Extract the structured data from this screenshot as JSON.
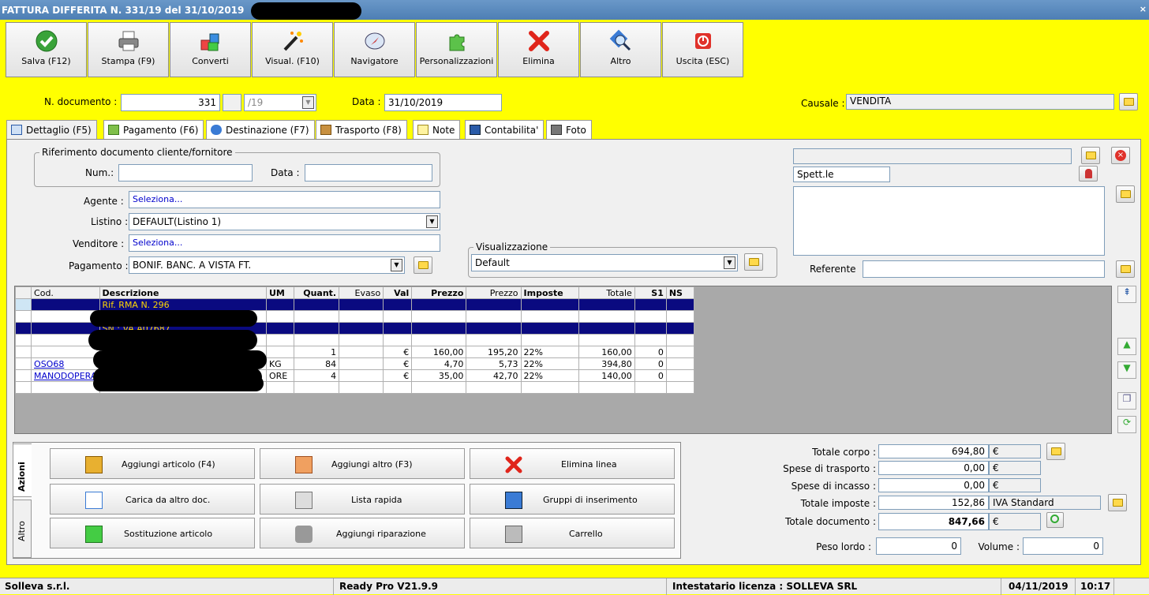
{
  "window": {
    "title": "FATTURA DIFFERITA N. 331/19 del 31/10/2019",
    "close": "×"
  },
  "toolbar": [
    {
      "label": "Salva (F12)",
      "icon": "save-check-icon"
    },
    {
      "label": "Stampa (F9)",
      "icon": "printer-icon"
    },
    {
      "label": "Converti",
      "icon": "convert-icon"
    },
    {
      "label": "Visual. (F10)",
      "icon": "magic-wand-icon"
    },
    {
      "label": "Navigatore",
      "icon": "compass-icon"
    },
    {
      "label": "Personalizzazioni",
      "icon": "puzzle-icon"
    },
    {
      "label": "Elimina",
      "icon": "delete-x-icon"
    },
    {
      "label": "Altro",
      "icon": "search-icon"
    },
    {
      "label": "Uscita (ESC)",
      "icon": "power-icon"
    }
  ],
  "header": {
    "ndoc_label": "N. documento :",
    "ndoc_value": "331",
    "suffix": "/19",
    "data_label": "Data :",
    "data_value": "31/10/2019",
    "causale_label": "Causale :",
    "causale_value": "VENDITA"
  },
  "tabs": [
    "Dettaglio (F5)",
    "Pagamento (F6)",
    "Destinazione (F7)",
    "Trasporto (F8)",
    "Note",
    "Contabilita'",
    "Foto"
  ],
  "rif": {
    "legend": "Riferimento documento cliente/fornitore",
    "num_label": "Num.:",
    "data_label": "Data :"
  },
  "form": {
    "agente_label": "Agente :",
    "agente_value": "Seleziona...",
    "listino_label": "Listino :",
    "listino_value": "DEFAULT(Listino 1)",
    "venditore_label": "Venditore :",
    "venditore_value": "Seleziona...",
    "pagamento_label": "Pagamento :",
    "pagamento_value": "BONIF. BANC. A VISTA FT."
  },
  "visual": {
    "legend": "Visualizzazione",
    "value": "Default"
  },
  "cliente": {
    "spett": "Spett.le",
    "referente_label": "Referente"
  },
  "grid": {
    "headers": [
      "Cod.",
      "Descrizione",
      "UM",
      "Quant.",
      "Evaso",
      "Val",
      "Prezzo",
      "Prezzo",
      "Imposte",
      "Totale",
      "S1",
      "NS"
    ],
    "rows": [
      {
        "sel": true,
        "cod": "",
        "desc": "Rif. RMA N. 296",
        "um": "",
        "q": "",
        "ev": "",
        "val": "",
        "p1": "",
        "p2": "",
        "imp": "",
        "tot": "",
        "s1": "",
        "ns": ""
      },
      {
        "sel": false,
        "cod": "",
        "desc": "",
        "um": "",
        "q": "",
        "ev": "",
        "val": "",
        "p1": "",
        "p2": "",
        "imp": "",
        "tot": "",
        "s1": "",
        "ns": ""
      },
      {
        "sel": true,
        "cod": "",
        "desc": "SN : VA A07687",
        "um": "",
        "q": "",
        "ev": "",
        "val": "",
        "p1": "",
        "p2": "",
        "imp": "",
        "tot": "",
        "s1": "",
        "ns": ""
      },
      {
        "sel": false,
        "cod": "",
        "desc": "",
        "um": "",
        "q": "",
        "ev": "",
        "val": "",
        "p1": "",
        "p2": "",
        "imp": "",
        "tot": "",
        "s1": "",
        "ns": ""
      },
      {
        "sel": false,
        "cod": "",
        "desc": "",
        "um": "",
        "q": "1",
        "ev": "",
        "val": "€",
        "p1": "160,00",
        "p2": "195,20",
        "imp": "22%",
        "tot": "160,00",
        "s1": "0",
        "ns": ""
      },
      {
        "sel": false,
        "cod": "OSO68",
        "desc": "",
        "um": "KG",
        "q": "84",
        "ev": "",
        "val": "€",
        "p1": "4,70",
        "p2": "5,73",
        "imp": "22%",
        "tot": "394,80",
        "s1": "0",
        "ns": ""
      },
      {
        "sel": false,
        "cod": "MANODOPERA",
        "desc": "",
        "um": "ORE",
        "q": "4",
        "ev": "",
        "val": "€",
        "p1": "35,00",
        "p2": "42,70",
        "imp": "22%",
        "tot": "140,00",
        "s1": "0",
        "ns": ""
      },
      {
        "sel": false,
        "cod": "",
        "desc": "",
        "um": "",
        "q": "",
        "ev": "",
        "val": "",
        "p1": "",
        "p2": "",
        "imp": "",
        "tot": "",
        "s1": "",
        "ns": ""
      }
    ]
  },
  "actions": {
    "tab_azioni": "Azioni",
    "tab_altro": "Altro",
    "buttons": [
      {
        "label": "Aggiungi articolo (F4)",
        "icon": "add-article-icon"
      },
      {
        "label": "Aggiungi altro (F3)",
        "icon": "add-grid-icon"
      },
      {
        "label": "Elimina linea",
        "icon": "delete-line-icon"
      },
      {
        "label": "Carica da altro doc.",
        "icon": "load-doc-icon"
      },
      {
        "label": "Lista rapida",
        "icon": "quick-list-icon"
      },
      {
        "label": "Gruppi di inserimento",
        "icon": "insert-group-icon"
      },
      {
        "label": "Sostituzione articolo",
        "icon": "replace-article-icon"
      },
      {
        "label": "Aggiungi riparazione",
        "icon": "wrench-icon"
      },
      {
        "label": "Carrello",
        "icon": "cart-icon"
      }
    ]
  },
  "totals": {
    "corpo_label": "Totale corpo :",
    "corpo": "694,80",
    "trasporto_label": "Spese di trasporto :",
    "trasporto": "0,00",
    "incasso_label": "Spese di incasso :",
    "incasso": "0,00",
    "imposte_label": "Totale imposte :",
    "imposte": "152,86",
    "iva": "IVA Standard",
    "documento_label": "Totale documento :",
    "documento": "847,66",
    "currency": "€",
    "peso_label": "Peso lordo :",
    "peso": "0",
    "volume_label": "Volume :",
    "volume": "0"
  },
  "status": {
    "company": "Solleva s.r.l.",
    "version": "Ready Pro V21.9.9",
    "license": "Intestatario licenza : SOLLEVA SRL",
    "date": "04/11/2019",
    "time": "10:17"
  }
}
